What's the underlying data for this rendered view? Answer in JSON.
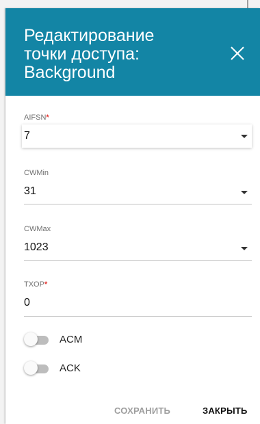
{
  "dialog": {
    "title": "Редактирование\nточки доступа:\nBackground",
    "header_color": "#1385a5"
  },
  "fields": {
    "aifsn": {
      "label": "AIFSN",
      "required": true,
      "value": "7",
      "type": "select"
    },
    "cwmin": {
      "label": "CWMin",
      "required": false,
      "value": "31",
      "type": "select"
    },
    "cwmax": {
      "label": "CWMax",
      "required": false,
      "value": "1023",
      "type": "select"
    },
    "txop": {
      "label": "TXOP",
      "required": true,
      "value": "0",
      "type": "text"
    }
  },
  "required_marker": "*",
  "toggles": [
    {
      "label": "ACM",
      "on": false
    },
    {
      "label": "ACK",
      "on": false
    }
  ],
  "actions": {
    "save_label": "СОХРАНИТЬ",
    "close_label": "ЗАКРЫТЬ"
  },
  "icons": {
    "close": "close-icon",
    "dropdown": "chevron-down-icon"
  }
}
